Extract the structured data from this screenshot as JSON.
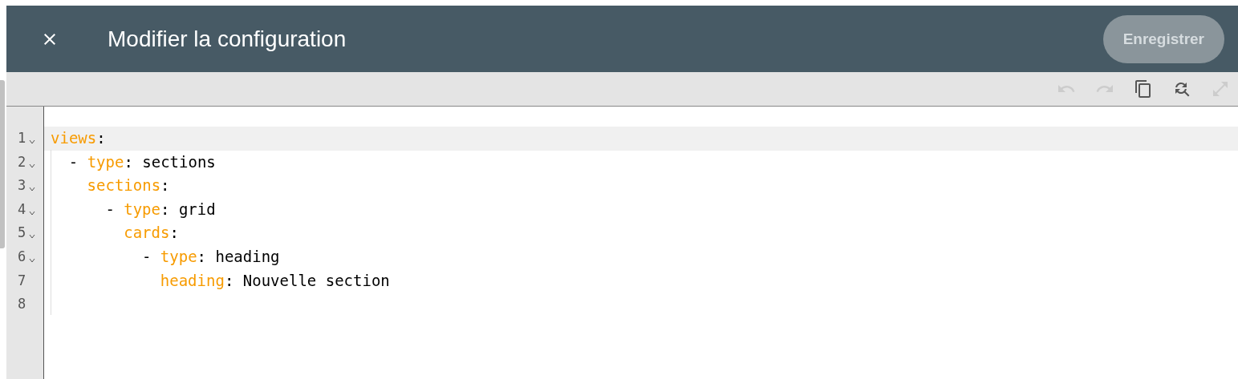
{
  "header": {
    "title": "Modifier la configuration",
    "save_button": {
      "label": "Enregistrer",
      "disabled": true
    }
  },
  "toolbar": [
    {
      "kind": "undo",
      "disabled": true
    },
    {
      "kind": "redo",
      "disabled": true
    },
    {
      "kind": "copy",
      "disabled": false
    },
    {
      "kind": "search-replace",
      "disabled": false
    },
    {
      "kind": "fullscreen",
      "disabled": true
    }
  ],
  "editor": {
    "lines": [
      {
        "number": "1",
        "active": true,
        "key": "views",
        "value": ":",
        "children": [
          {
            "number": "2",
            "active": false,
            "bullet": "-",
            "key": "type",
            "value": ": sections",
            "children": [
              {
                "number": "3",
                "active": false,
                "key": "sections",
                "value": ":",
                "children": [
                  {
                    "number": "4",
                    "active": false,
                    "bullet": "-",
                    "key": "type",
                    "value": ": grid",
                    "children": [
                      {
                        "number": "5",
                        "active": false,
                        "key": "cards",
                        "value": ":",
                        "children": [
                          {
                            "number": "6",
                            "active": false,
                            "bullet": "-",
                            "key": "type",
                            "value": ": heading",
                            "children": [
                              {
                                "number": "7",
                                "active": false,
                                "key": "heading",
                                "value": ": Nouvelle section"
                              }
                            ]
                          }
                        ]
                      }
                    ]
                  }
                ]
              }
            ]
          }
        ]
      },
      {
        "number": "8",
        "active": false
      }
    ]
  }
}
